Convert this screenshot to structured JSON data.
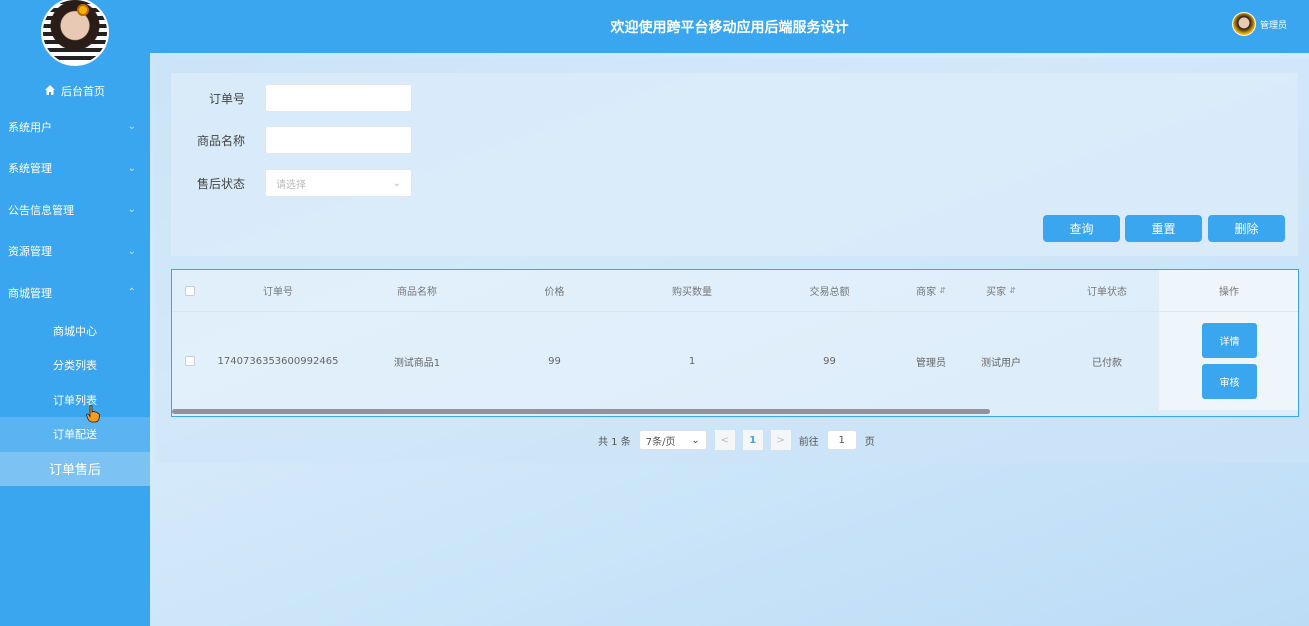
{
  "header": {
    "title": "欢迎使用跨平台移动应用后端服务设计",
    "user": "管理员"
  },
  "sidebar": {
    "home": "后台首页",
    "menus": [
      {
        "label": "系统用户",
        "chevron": "chevron-down-icon"
      },
      {
        "label": "系统管理",
        "chevron": "chevron-down-icon"
      },
      {
        "label": "公告信息管理",
        "chevron": "chevron-down-icon"
      },
      {
        "label": "资源管理",
        "chevron": "chevron-down-icon"
      },
      {
        "label": "商城管理",
        "chevron": "chevron-up-icon"
      }
    ],
    "submenus": [
      "商城中心",
      "分类列表",
      "订单列表",
      "订单配送",
      "订单售后"
    ]
  },
  "search": {
    "order_no_label": "订单号",
    "product_name_label": "商品名称",
    "after_sale_label": "售后状态",
    "after_sale_placeholder": "请选择",
    "buttons": {
      "query": "查询",
      "reset": "重置",
      "delete": "删除"
    }
  },
  "table": {
    "columns": [
      "订单号",
      "商品名称",
      "价格",
      "购买数量",
      "交易总额",
      "商家",
      "买家",
      "订单状态",
      "操作"
    ],
    "rows": [
      {
        "order_no": "1740736353600992465",
        "product": "测试商品1",
        "price": "99",
        "qty": "1",
        "total": "99",
        "seller": "管理员",
        "buyer": "测试用户",
        "status": "已付款",
        "detail": "详情",
        "review": "审核"
      }
    ]
  },
  "pagination": {
    "total": "共 1 条",
    "page_size": "7条/页",
    "current": "1",
    "goto_label": "前往",
    "goto_value": "1",
    "page_suffix": "页"
  },
  "colors": {
    "primary": "#3aa6f0"
  }
}
